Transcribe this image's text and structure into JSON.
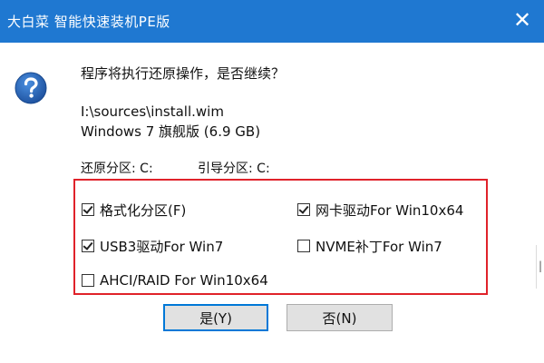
{
  "window": {
    "title": "大白菜 智能快速装机PE版",
    "close_glyph": "✕",
    "titlebar_color": "#1f78d1"
  },
  "dialog": {
    "icon": "question-icon",
    "prompt": "程序将执行还原操作，是否继续？",
    "image_path": "I:\\sources\\install.wim",
    "edition": "Windows 7 旗舰版 (6.9 GB)",
    "restore_partition": "还原分区: C:",
    "boot_partition": "引导分区: C:"
  },
  "options": [
    {
      "label": "格式化分区(F)",
      "checked": true
    },
    {
      "label": "网卡驱动For Win10x64",
      "checked": true
    },
    {
      "label": "USB3驱动For Win7",
      "checked": true
    },
    {
      "label": "NVME补丁For Win7",
      "checked": false
    },
    {
      "label": "AHCI/RAID For Win10x64",
      "checked": false
    }
  ],
  "highlight_color": "#e0222a",
  "buttons": {
    "yes": "是(Y)",
    "no": "否(N)"
  }
}
